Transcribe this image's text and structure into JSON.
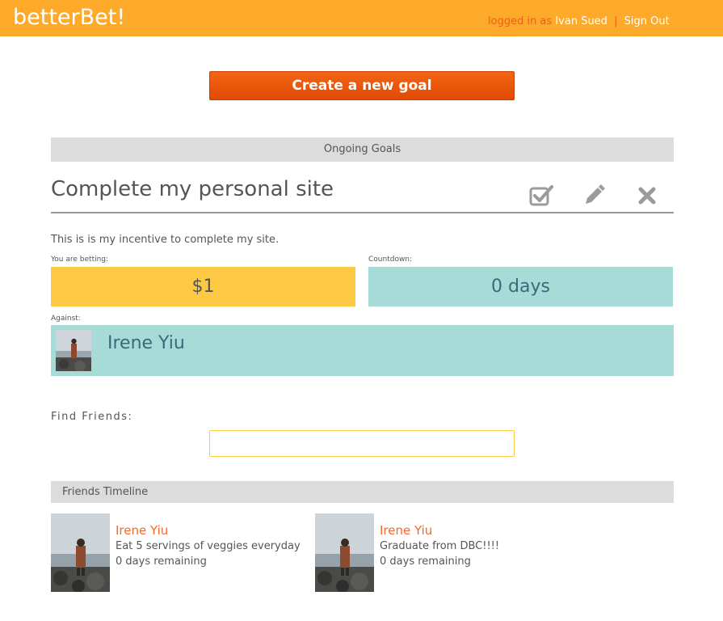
{
  "header": {
    "brand": "betterBet!",
    "logged_in_label": "logged in as",
    "user_name": "Ivan Sued",
    "separator": "|",
    "sign_out": "Sign Out"
  },
  "create_goal_label": "Create a new goal",
  "ongoing_goals_title": "Ongoing Goals",
  "goal": {
    "title": "Complete my personal site",
    "incentive": "This is is my incentive to complete my site.",
    "betting_label": "You are betting:",
    "bet_amount": "$1",
    "countdown_label": "Countdown:",
    "countdown_value": "0 days",
    "against_label": "Against:",
    "against_name": "Irene Yiu",
    "actions": [
      "check-icon",
      "pencil-icon",
      "close-icon"
    ]
  },
  "find_friends": {
    "label": "Find Friends:",
    "value": "",
    "placeholder": ""
  },
  "timeline": {
    "title": "Friends Timeline",
    "items": [
      {
        "name": "Irene Yiu",
        "goal": "Eat 5 servings of veggies everyday",
        "remaining": "0 days remaining"
      },
      {
        "name": "Irene Yiu",
        "goal": "Graduate from DBC!!!!",
        "remaining": "0 days remaining"
      }
    ]
  },
  "colors": {
    "header_bg": "#fdaa2a",
    "accent_orange": "#e8550a",
    "bet_yellow": "#fdc945",
    "teal": "#a6dbd8",
    "teal_text": "#3b6a78",
    "name_orange": "#f26a2e"
  }
}
